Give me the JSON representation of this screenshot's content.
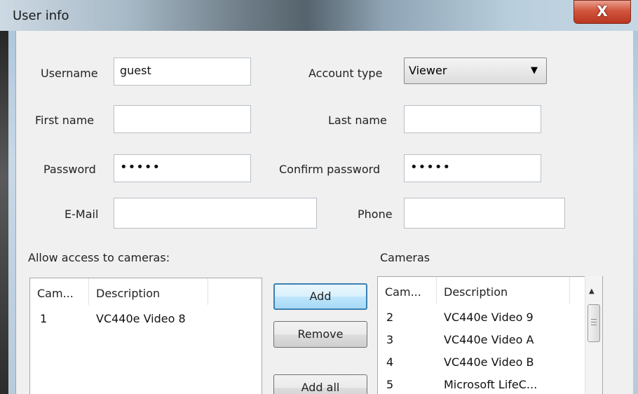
{
  "window": {
    "title": "User info",
    "close_label": "X"
  },
  "form": {
    "username_label": "Username",
    "username_value": "guest",
    "account_type_label": "Account type",
    "account_type_value": "Viewer",
    "first_name_label": "First name",
    "first_name_value": "",
    "last_name_label": "Last name",
    "last_name_value": "",
    "password_label": "Password",
    "password_value": "•••••",
    "confirm_password_label": "Confirm password",
    "confirm_password_value": "•••••",
    "email_label": "E-Mail",
    "email_value": "",
    "phone_label": "Phone",
    "phone_value": ""
  },
  "allowed": {
    "label": "Allow access to cameras:",
    "columns": [
      "Cam...",
      "Description"
    ],
    "rows": [
      {
        "cam": "1",
        "description": "VC440e Video 8"
      }
    ]
  },
  "buttons": {
    "add": "Add",
    "remove": "Remove",
    "add_all": "Add all"
  },
  "cameras": {
    "label": "Cameras",
    "columns": [
      "Cam...",
      "Description"
    ],
    "rows": [
      {
        "cam": "2",
        "description": "VC440e Video 9"
      },
      {
        "cam": "3",
        "description": "VC440e Video A"
      },
      {
        "cam": "4",
        "description": "VC440e Video B"
      },
      {
        "cam": "5",
        "description": "Microsoft LifeC..."
      }
    ]
  },
  "icons": {
    "dropdown": "chevron-down-icon",
    "close": "close-icon",
    "scroll_up": "scroll-up-icon"
  }
}
